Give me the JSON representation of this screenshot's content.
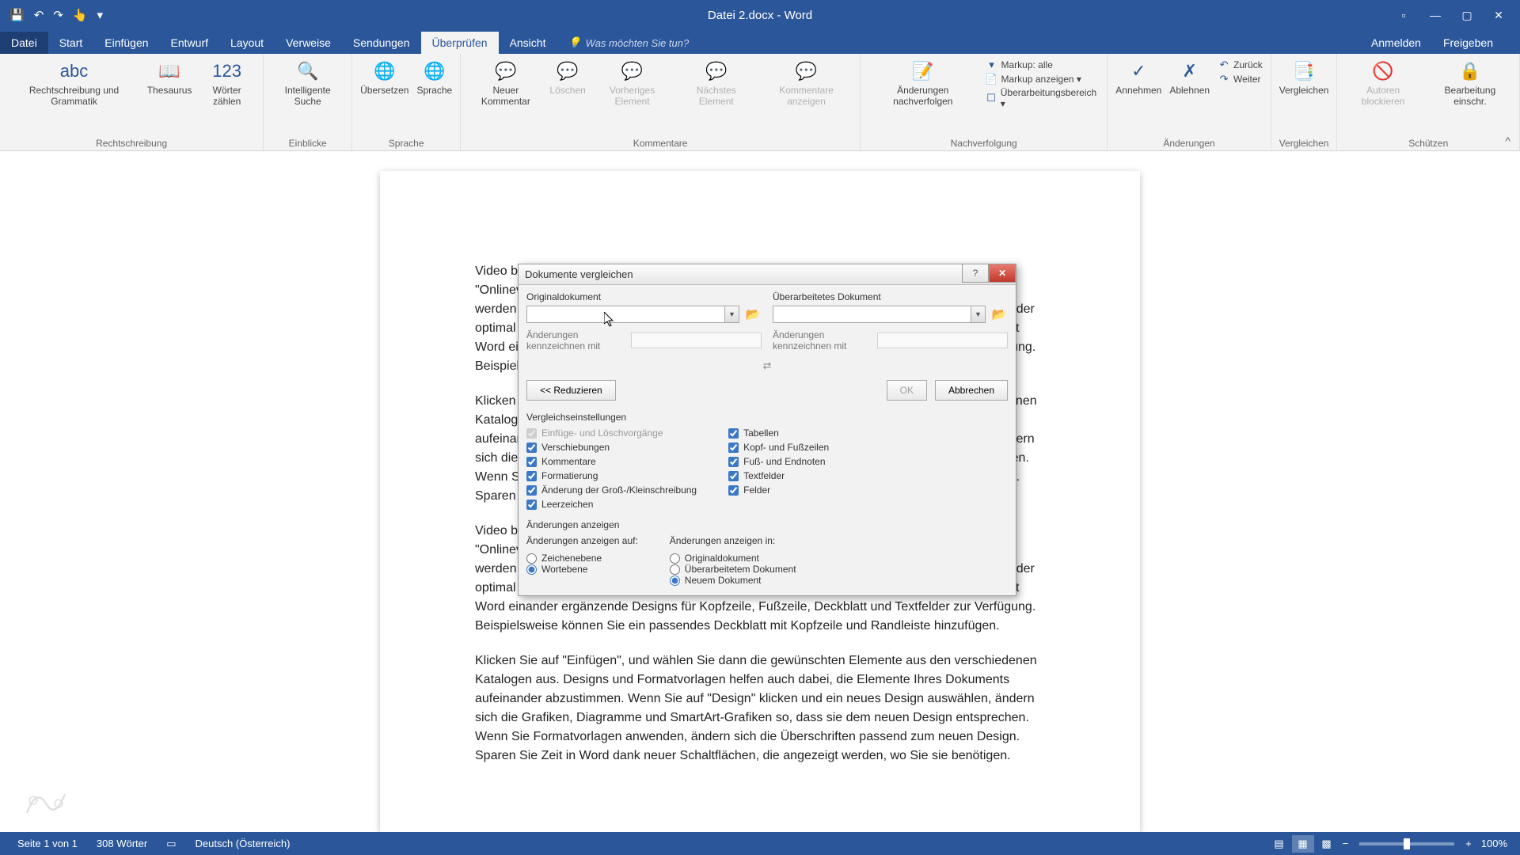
{
  "window": {
    "title": "Datei 2.docx - Word",
    "qat": {
      "save_icon": "💾",
      "undo_icon": "↶",
      "redo_icon": "↷",
      "touch_icon": "👆"
    }
  },
  "win_controls": {
    "opts": "▫",
    "min": "—",
    "max": "▢",
    "close": "✕"
  },
  "tabs": {
    "file": "Datei",
    "items": [
      "Start",
      "Einfügen",
      "Entwurf",
      "Layout",
      "Verweise",
      "Sendungen",
      "Überprüfen",
      "Ansicht"
    ],
    "active_index": 6,
    "tellme_placeholder": "Was möchten Sie tun?",
    "anmelden": "Anmelden",
    "freigeben": "Freigeben"
  },
  "ribbon": {
    "groups": [
      {
        "label": "Rechtschreibung",
        "buttons": [
          {
            "icon": "abc",
            "text": "Rechtschreibung\nund Grammatik"
          },
          {
            "icon": "📖",
            "text": "Thesaurus"
          },
          {
            "icon": "123",
            "text": "Wörter\nzählen"
          }
        ]
      },
      {
        "label": "Einblicke",
        "buttons": [
          {
            "icon": "🔍",
            "text": "Intelligente\nSuche"
          }
        ]
      },
      {
        "label": "Sprache",
        "buttons": [
          {
            "icon": "🌐",
            "text": "Übersetzen"
          },
          {
            "icon": "🌐",
            "text": "Sprache"
          }
        ]
      },
      {
        "label": "Kommentare",
        "buttons": [
          {
            "icon": "💬",
            "text": "Neuer\nKommentar"
          },
          {
            "icon": "💬",
            "text": "Löschen",
            "disabled": true
          },
          {
            "icon": "💬",
            "text": "Vorheriges\nElement",
            "disabled": true
          },
          {
            "icon": "💬",
            "text": "Nächstes\nElement",
            "disabled": true
          },
          {
            "icon": "💬",
            "text": "Kommentare\nanzeigen",
            "disabled": true
          }
        ]
      },
      {
        "label": "Nachverfolgung",
        "buttons": [
          {
            "icon": "📝",
            "text": "Änderungen\nnachverfolgen"
          }
        ],
        "small": [
          {
            "icon": "▾",
            "text": "Markup: alle"
          },
          {
            "icon": "📄",
            "text": "Markup anzeigen ▾"
          },
          {
            "icon": "☐",
            "text": "Überarbeitungsbereich ▾"
          }
        ]
      },
      {
        "label": "Änderungen",
        "buttons": [
          {
            "icon": "✓",
            "text": "Annehmen"
          },
          {
            "icon": "✗",
            "text": "Ablehnen"
          }
        ],
        "small": [
          {
            "icon": "↶",
            "text": "Zurück"
          },
          {
            "icon": "↷",
            "text": "Weiter"
          }
        ]
      },
      {
        "label": "Vergleichen",
        "buttons": [
          {
            "icon": "📑",
            "text": "Vergleichen"
          }
        ]
      },
      {
        "label": "Schützen",
        "buttons": [
          {
            "icon": "🚫",
            "text": "Autoren\nblockieren",
            "disabled": true
          },
          {
            "icon": "🔒",
            "text": "Bearbeitung\neinschr."
          }
        ]
      }
    ],
    "collapse_icon": "^"
  },
  "document": {
    "para1": "Video bietet eine leistungsstarke Möglichkeit zur Unterstützung Ihres Standpunkts. Wenn Sie auf \"Onlinevideo\" klicken, können Sie den Einbettungscode für das Video einfügen, das hinzugefügt werden soll. Sie können auch ein Stichwort eingeben, um online nach dem Videoclip zu suchen, der optimal zu Ihrem Dokument passt. Damit Ihr Dokument ein professionelles Aussehen erhält, stellt Word einander ergänzende Designs für Kopfzeile, Fußzeile, Deckblatt und Textfelder zur Verfügung. Beispielsweise können Sie ein passendes Deckblatt mit Kopfzeile und Randleiste hinzufügen.",
    "para2": "Klicken Sie auf \"Einfügen\", und wählen Sie dann die gewünschten Elemente aus den verschiedenen Katalogen aus. Designs und Formatvorlagen helfen auch dabei, die Elemente Ihres Dokuments aufeinander abzustimmen. Wenn Sie auf \"Design\" klicken und ein neues Design auswählen, ändern sich die Grafiken, Diagramme und SmartArt-Grafiken so, dass sie dem neuen Design entsprechen. Wenn Sie Formatvorlagen anwenden, ändern sich die Überschriften passend zum neuen Design. Sparen Sie Zeit in Word dank neuer Schaltflächen, die angezeigt werden, wo Sie sie benötigen.",
    "para3": "Video bietet eine leistungsstarke Möglichkeit zur Unterstützung Ihres Standpunkts. Wenn Sie auf \"Onlinevideo\" klicken, können Sie den Einbettungscode für das Video einfügen, das hinzugefügt werden soll. Sie können auch ein Stichwort eingeben, um online nach dem Videoclip zu suchen, der optimal zu Ihrem Dokument passt. Damit Ihr Dokument ein professionelles Aussehen erhält, stellt Word einander ergänzende Designs für Kopfzeile, Fußzeile, Deckblatt und Textfelder zur Verfügung. Beispielsweise können Sie ein passendes Deckblatt mit Kopfzeile und Randleiste hinzufügen.",
    "para4": "Klicken Sie auf \"Einfügen\", und wählen Sie dann die gewünschten Elemente aus den verschiedenen Katalogen aus. Designs und Formatvorlagen helfen auch dabei, die Elemente Ihres Dokuments aufeinander abzustimmen. Wenn Sie auf \"Design\" klicken und ein neues Design auswählen, ändern sich die Grafiken, Diagramme und SmartArt-Grafiken so, dass sie dem neuen Design entsprechen. Wenn Sie Formatvorlagen anwenden, ändern sich die Überschriften passend zum neuen Design. Sparen Sie Zeit in Word dank neuer Schaltflächen, die angezeigt werden, wo Sie sie benötigen."
  },
  "dialog": {
    "title": "Dokumente vergleichen",
    "help_icon": "?",
    "close_icon": "✕",
    "original_label": "Originaldokument",
    "revised_label": "Überarbeitetes Dokument",
    "browse_icon": "📂",
    "mark_label": "Änderungen kennzeichnen mit",
    "swap_icon": "⇄",
    "reduce_btn": "<< Reduzieren",
    "ok_btn": "OK",
    "cancel_btn": "Abbrechen",
    "compare_settings_label": "Vergleichseinstellungen",
    "checks_left": [
      {
        "label": "Einfüge- und Löschvorgänge",
        "checked": true,
        "disabled": true
      },
      {
        "label": "Verschiebungen",
        "checked": true
      },
      {
        "label": "Kommentare",
        "checked": true
      },
      {
        "label": "Formatierung",
        "checked": true
      },
      {
        "label": "Änderung der Groß-/Kleinschreibung",
        "checked": true
      },
      {
        "label": "Leerzeichen",
        "checked": true
      }
    ],
    "checks_right": [
      {
        "label": "Tabellen",
        "checked": true
      },
      {
        "label": "Kopf- und Fußzeilen",
        "checked": true
      },
      {
        "label": "Fuß- und Endnoten",
        "checked": true
      },
      {
        "label": "Textfelder",
        "checked": true
      },
      {
        "label": "Felder",
        "checked": true
      }
    ],
    "show_changes_label": "Änderungen anzeigen",
    "show_at_label": "Änderungen anzeigen auf:",
    "show_at": [
      {
        "label": "Zeichenebene",
        "checked": false
      },
      {
        "label": "Wortebene",
        "checked": true
      }
    ],
    "show_in_label": "Änderungen anzeigen in:",
    "show_in": [
      {
        "label": "Originaldokument",
        "checked": false
      },
      {
        "label": "Überarbeitetem Dokument",
        "checked": false
      },
      {
        "label": "Neuem Dokument",
        "checked": true
      }
    ]
  },
  "statusbar": {
    "page": "Seite 1 von 1",
    "words": "308 Wörter",
    "lang_icon": "▭",
    "language": "Deutsch (Österreich)",
    "zoom": "100%"
  }
}
